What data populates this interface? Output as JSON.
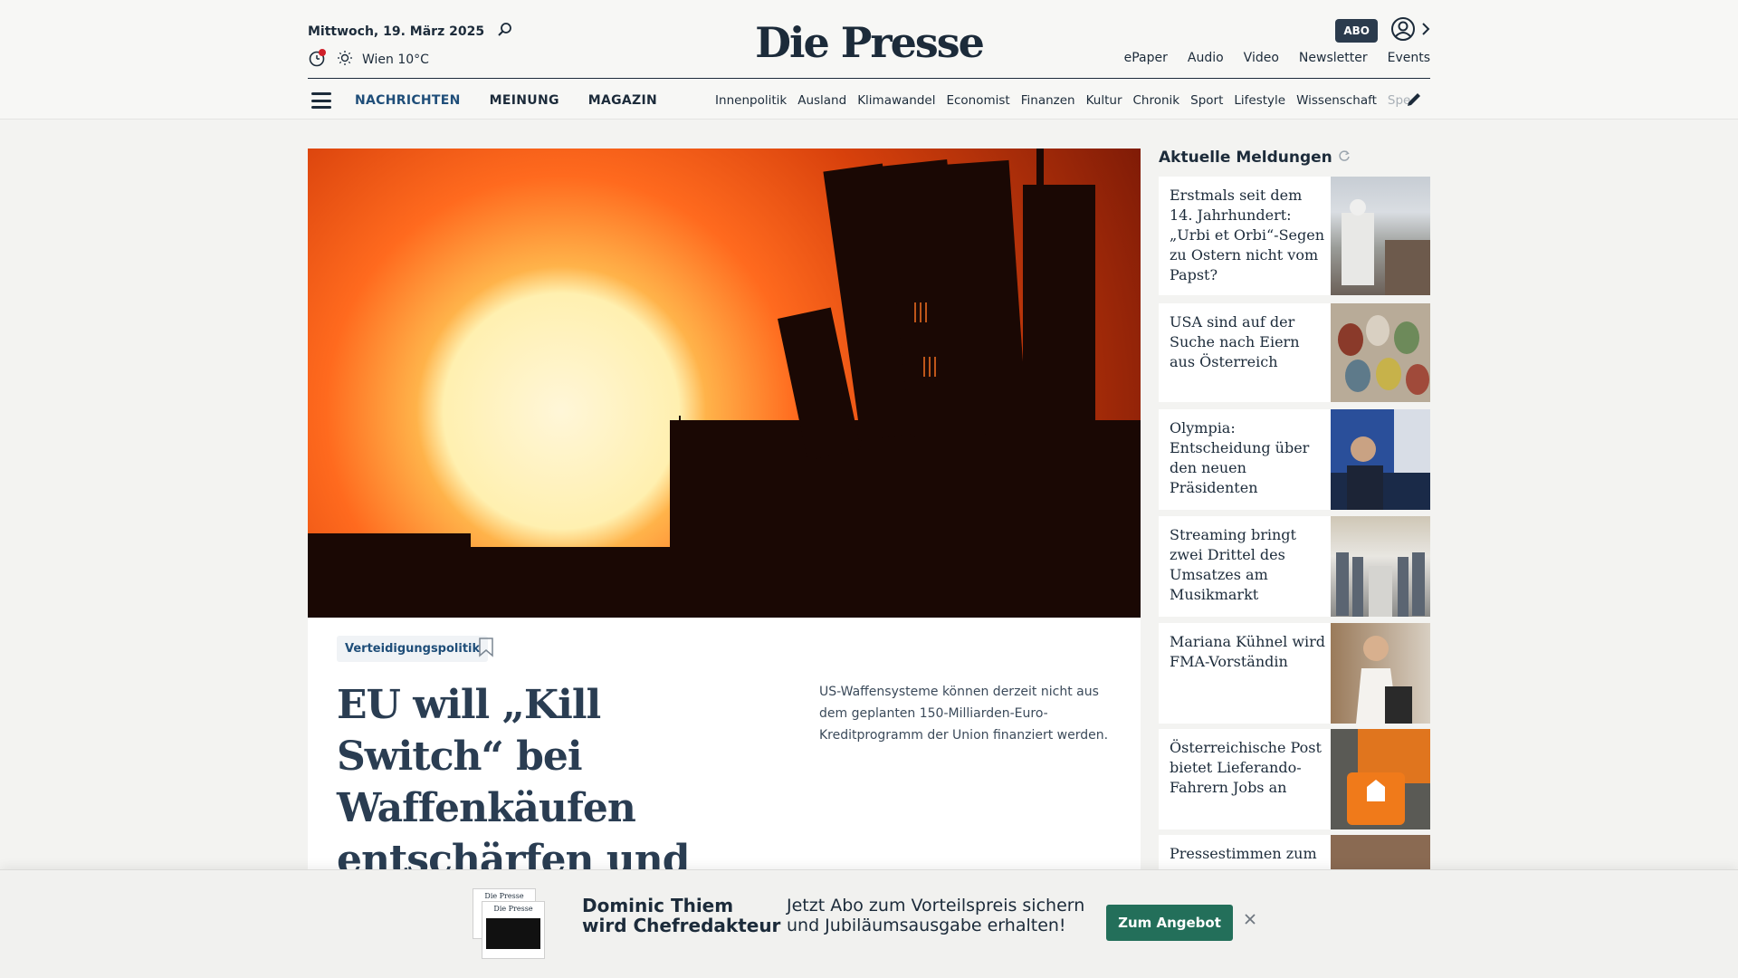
{
  "header": {
    "date": "Mittwoch, 19. März 2025",
    "weather": "Wien 10°C",
    "logo": "Die Presse",
    "abo_label": "ABO",
    "top_links": [
      "ePaper",
      "Audio",
      "Video",
      "Newsletter",
      "Events"
    ]
  },
  "nav": {
    "main": [
      "NACHRICHTEN",
      "MEINUNG",
      "MAGAZIN"
    ],
    "sub": [
      "Innenpolitik",
      "Ausland",
      "Klimawandel",
      "Economist",
      "Finanzen",
      "Kultur",
      "Chronik",
      "Sport",
      "Lifestyle",
      "Wissenschaft"
    ],
    "sub_faded": "Spectr"
  },
  "article": {
    "tag": "Verteidigungspolitik",
    "headline": "EU will „Kill Switch“ bei Waffenkäufen entschärfen und schließt US-",
    "teaser": "US-Waffensysteme können derzeit nicht aus dem geplanten 150-Milliarden-Euro-Kreditprogramm der Union finanziert werden."
  },
  "sidebar": {
    "title": "Aktuelle Meldungen",
    "items": [
      {
        "text": "Erstmals seit dem 14. Jahrhundert: „Urbi et Orbi“-Segen zu Ostern nicht vom Papst?"
      },
      {
        "text": "USA sind auf der Suche nach Eiern aus Österreich"
      },
      {
        "text": "Olympia: Entscheidung über den neuen Präsidenten"
      },
      {
        "text": "Streaming bringt zwei Drittel des Umsatzes am Musikmarkt"
      },
      {
        "text": "Mariana Kühnel wird FMA-Vorständin"
      },
      {
        "text": "Österreichische Post bietet Lieferando-Fahrern Jobs an"
      },
      {
        "text": "Pressestimmen zum"
      }
    ]
  },
  "banner": {
    "paper_label_1": "Die Presse",
    "paper_label_2": "Die Presse",
    "title": "Dominic Thiem wird Chefredakteur",
    "text": "Jetzt Abo zum Vorteilspreis sichern und Jubiläumsausgabe erhalten!",
    "cta": "Zum Angebot"
  },
  "colors": {
    "brand": "#1c2b3a",
    "accent": "#1f4e79",
    "cta": "#236f5a"
  },
  "icons": [
    "search-icon",
    "clock-icon",
    "sun-icon",
    "user-icon",
    "chevron-right-icon",
    "menu-icon",
    "pencil-icon",
    "bookmark-icon",
    "refresh-icon",
    "close-icon"
  ]
}
